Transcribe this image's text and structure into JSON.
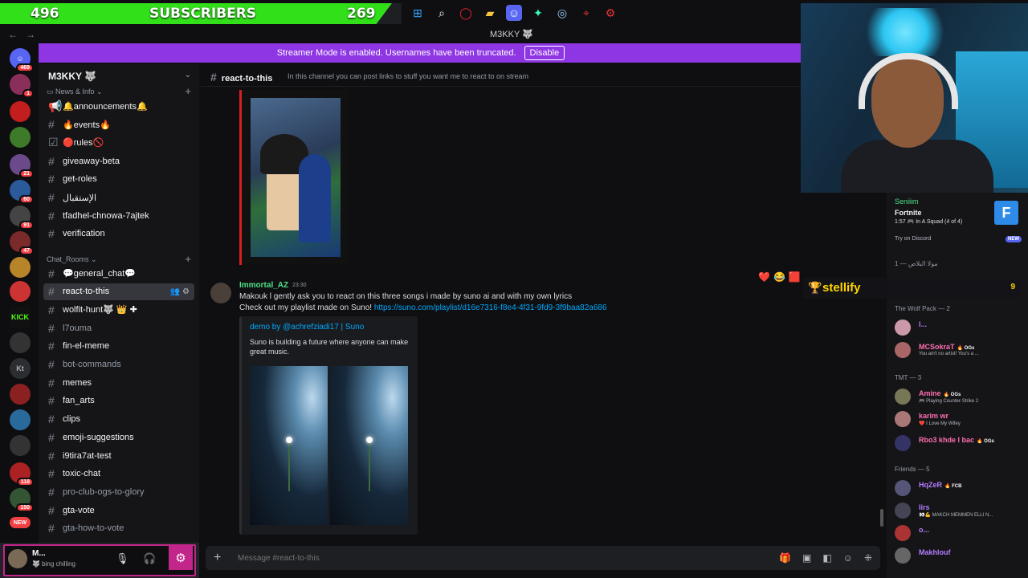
{
  "overlay": {
    "left_count": "496",
    "label": "SUBSCRIBERS",
    "right_count": "269",
    "accent": "#32e01a"
  },
  "window": {
    "title": "M3KKY 🐺"
  },
  "banner": {
    "text": "Streamer Mode is enabled. Usernames have been truncated.",
    "button": "Disable",
    "color": "#8f36e4"
  },
  "rail": {
    "badges": [
      "469",
      "1",
      "",
      "",
      "21",
      "60",
      "91",
      "47",
      "",
      "",
      "",
      "",
      "",
      "",
      "118",
      "150",
      "NEW"
    ],
    "kick_label": "KICK",
    "kt_label": "Kt"
  },
  "server": {
    "name": "M3KKY 🐺"
  },
  "categories": {
    "news": "News & Info",
    "chat": "Chat_Rooms"
  },
  "channels_news": [
    {
      "label": "🔔announcements🔔",
      "icon": "megaphone"
    },
    {
      "label": "🔥events🔥",
      "icon": "hash"
    },
    {
      "label": "🔴rules🚫",
      "icon": "rules"
    },
    {
      "label": "giveaway-beta",
      "icon": "hash"
    },
    {
      "label": "get-roles",
      "icon": "hash"
    },
    {
      "label": "الإستقبال",
      "icon": "hash"
    },
    {
      "label": "tfadhel-chnowa-7ajtek",
      "icon": "hash"
    },
    {
      "label": "verification",
      "icon": "hash"
    }
  ],
  "channels_chat": [
    {
      "label": "💬general_chat💬",
      "icon": "hash"
    },
    {
      "label": "react-to-this",
      "icon": "hash"
    },
    {
      "label": "wolfit-hunt🐺 👑 ✚",
      "icon": "hash"
    },
    {
      "label": "l7ouma",
      "icon": "hash"
    },
    {
      "label": "fin-el-meme",
      "icon": "hash"
    },
    {
      "label": "bot-commands",
      "icon": "hash"
    },
    {
      "label": "memes",
      "icon": "hash"
    },
    {
      "label": "fan_arts",
      "icon": "hash"
    },
    {
      "label": "clips",
      "icon": "hash"
    },
    {
      "label": "emoji-suggestions",
      "icon": "hash"
    },
    {
      "label": "i9tira7at-test",
      "icon": "hash"
    },
    {
      "label": "toxic-chat",
      "icon": "hash"
    },
    {
      "label": "pro-club-ogs-to-glory",
      "icon": "hash"
    },
    {
      "label": "gta-vote",
      "icon": "hash"
    },
    {
      "label": "gta-how-to-vote",
      "icon": "hash"
    }
  ],
  "user": {
    "name": "M...",
    "status": "🐺 bing chilling"
  },
  "channel": {
    "name": "react-to-this",
    "topic": "In this channel you can post links to stuff you want me to react to on stream"
  },
  "message": {
    "author": "Immortal_AZ",
    "time": "23:30",
    "line1": "Makouk l gently ask you to react on this three songs i made by suno ai and with my own lyrics",
    "line2_prefix": "Check out my playlist made on Suno! ",
    "link": "https://suno.com/playlist/d16e7316-f8e4-4f31-9fd9-3f9baa82a686",
    "embed_title": "demo  by @achrefziadi17 | Suno",
    "embed_desc": "Suno is building a future where anyone can make great music."
  },
  "input": {
    "placeholder": "Message #react-to-this"
  },
  "activity": {
    "user": "Seniiim",
    "game": "Fortnite",
    "detail": "1:57  🎮 In A Squad (4 of 4)",
    "try": "Try on Discord",
    "new_badge": "NEW"
  },
  "stellify": {
    "name": "stellify",
    "count": "9"
  },
  "member_groups": [
    {
      "label": "مولا البلاص — 1"
    },
    {
      "label": "The Wolf Pack — 2"
    },
    {
      "label": "TMT — 3"
    },
    {
      "label": "Friends — 5"
    }
  ],
  "members": [
    {
      "name": "l...",
      "status": "",
      "color": "#b57cff",
      "tag": ""
    },
    {
      "name": "MCSokraT",
      "status": "You ain't no artist! You's a ...",
      "color": "#ff6fb0",
      "tag": "🔥 OGs"
    },
    {
      "name": "Amine",
      "status": "🎮 Playing Counter-Strike 2",
      "color": "#ff6fb0",
      "tag": "🔥 OGs"
    },
    {
      "name": "karim wr",
      "status": "❤️ I Love My Wifey",
      "color": "#ff6fb0",
      "tag": ""
    },
    {
      "name": "Rbo3 khde l bac",
      "status": "",
      "color": "#ff6fb0",
      "tag": "🔥 OGs"
    },
    {
      "name": "HqZeR",
      "status": "",
      "color": "#b57cff",
      "tag": "🔥 FCB"
    },
    {
      "name": "lirs",
      "status": "👀💪 MAKCH MEMMEN ELLI N...",
      "color": "#b57cff",
      "tag": ""
    },
    {
      "name": "o...",
      "status": "",
      "color": "#b57cff",
      "tag": ""
    },
    {
      "name": "Makhlouf",
      "status": "",
      "color": "#b57cff",
      "tag": ""
    }
  ]
}
